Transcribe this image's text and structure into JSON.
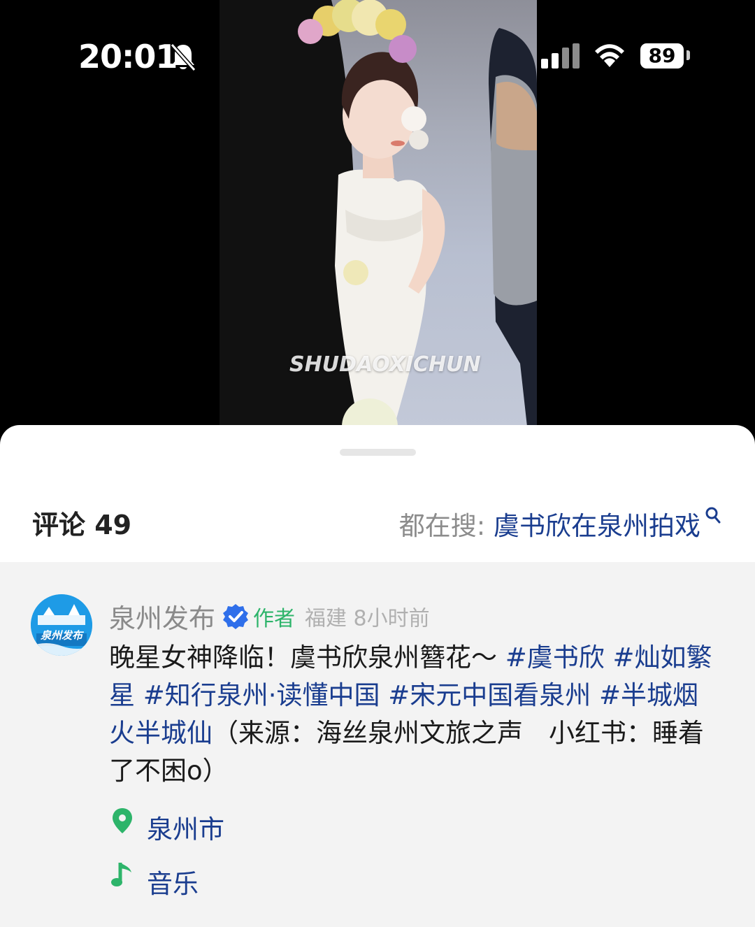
{
  "status_bar": {
    "time": "20:01",
    "battery": "89"
  },
  "video": {
    "watermark": "SHUDAOXICHUN"
  },
  "header": {
    "comment_count": "评论 49",
    "search_prefix": "都在搜: ",
    "search_term": "虞书欣在泉州拍戏"
  },
  "comment": {
    "author": "泉州发布",
    "author_tag": "作者",
    "author_meta": "福建 8小时前",
    "avatar_text": "泉州发布",
    "text_plain_1": "晚星女神降临！虞书欣泉州簪花～",
    "tags_1": [
      " #虞书欣",
      " #灿如繁星",
      " #知行泉州·读懂中国",
      " #宋元中国看泉州",
      " #半城烟火半城仙"
    ],
    "text_plain_2": "（来源：海丝泉州文旅之声　小红书：睡着了不困o）",
    "location": "泉州市",
    "music": "音乐"
  },
  "colors": {
    "link": "#1a3d8f",
    "author_tag": "#2db46a",
    "location_pin": "#2db46a",
    "verified": "#2f6fea"
  },
  "icons": [
    "bell-slash-icon",
    "signal-icon",
    "wifi-icon",
    "search-icon",
    "verified-icon",
    "location-pin-icon",
    "music-note-icon"
  ]
}
